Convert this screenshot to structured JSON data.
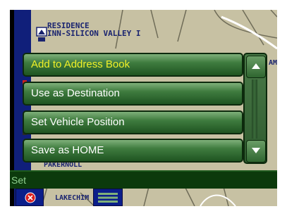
{
  "map": {
    "poi_lines": [
      "RESIDENCE",
      "INN-SILICON VALLEY I"
    ],
    "streets": [
      "PAKERNOLL",
      "LAKECHIM"
    ],
    "edge_letters": [
      "AM"
    ]
  },
  "menu": {
    "items": [
      {
        "label": "Add to Address Book",
        "selected": true
      },
      {
        "label": "Use as Destination",
        "selected": false
      },
      {
        "label": "Set Vehicle Position",
        "selected": false
      },
      {
        "label": "Save as HOME",
        "selected": false
      }
    ]
  },
  "input": {
    "value": "Set"
  },
  "colors": {
    "menu_selected_text": "#f0f028",
    "menu_text": "#ffffff",
    "input_bg": "#0c3a0c",
    "button_bg": "#0b1e8a"
  },
  "icons": {
    "scroll_up": "up-arrow-icon",
    "scroll_down": "down-arrow-icon",
    "cancel": "cancel-circle-x-icon",
    "list": "list-icon",
    "poi": "hotel-poi-icon"
  }
}
